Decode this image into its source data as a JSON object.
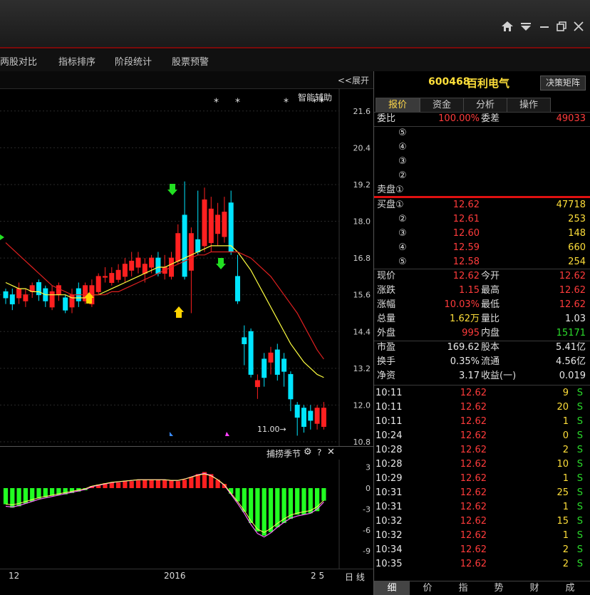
{
  "menu": [
    "两股对比",
    "指标排序",
    "阶段统计",
    "股票预警"
  ],
  "chart_header": {
    "expand_label": "<<展开",
    "assist_label": "智能辅助"
  },
  "y_axis_labels": [
    "21.6",
    "20.4",
    "19.2",
    "18.0",
    "16.8",
    "15.6",
    "14.4",
    "13.2",
    "12.0",
    "10.8"
  ],
  "annot": {
    "low": "11.00→"
  },
  "sub_chart": {
    "title": "捕捞季节",
    "axis": [
      "3",
      "0",
      "-3",
      "-6",
      "-9"
    ]
  },
  "x_axis": {
    "labels": [
      "12",
      "2016",
      "2 5"
    ],
    "period": "日 线"
  },
  "stock": {
    "code": "600468",
    "name": "百利电气",
    "button": "决策矩阵"
  },
  "tabs": [
    "报价",
    "资金",
    "分析",
    "操作"
  ],
  "order_ratio": {
    "label": "委比",
    "value": "100.00%",
    "diff_label": "委差",
    "diff_value": "49033"
  },
  "sell": [
    {
      "label": "⑤",
      "price": "",
      "vol": ""
    },
    {
      "label": "④",
      "price": "",
      "vol": ""
    },
    {
      "label": "③",
      "price": "",
      "vol": ""
    },
    {
      "label": "②",
      "price": "",
      "vol": ""
    },
    {
      "label": "卖盘①",
      "price": "",
      "vol": ""
    }
  ],
  "buy": [
    {
      "label": "买盘①",
      "price": "12.62",
      "vol": "47718"
    },
    {
      "label": "②",
      "price": "12.61",
      "vol": "253"
    },
    {
      "label": "③",
      "price": "12.60",
      "vol": "148"
    },
    {
      "label": "④",
      "price": "12.59",
      "vol": "660"
    },
    {
      "label": "⑤",
      "price": "12.58",
      "vol": "254"
    }
  ],
  "quote": [
    {
      "l1": "现价",
      "v1": "12.62",
      "c1": "red",
      "l2": "今开",
      "v2": "12.62",
      "c2": "red"
    },
    {
      "l1": "涨跌",
      "v1": "1.15",
      "c1": "red",
      "l2": "最高",
      "v2": "12.62",
      "c2": "red"
    },
    {
      "l1": "涨幅",
      "v1": "10.03%",
      "c1": "red",
      "l2": "最低",
      "v2": "12.62",
      "c2": "red"
    },
    {
      "l1": "总量",
      "v1": "1.62万",
      "c1": "yel",
      "l2": "量比",
      "v2": "1.03",
      "c2": "wht"
    },
    {
      "l1": "外盘",
      "v1": "995",
      "c1": "red",
      "l2": "内盘",
      "v2": "15171",
      "c2": "grn"
    }
  ],
  "fund": [
    {
      "l1": "市盈",
      "v1": "169.62",
      "l2": "股本",
      "v2": "5.41亿"
    },
    {
      "l1": "换手",
      "v1": "0.35%",
      "l2": "流通",
      "v2": "4.56亿"
    },
    {
      "l1": "净资",
      "v1": "3.17",
      "l2": "收益(一)",
      "v2": "0.019"
    }
  ],
  "ticks": [
    {
      "t": "10:11",
      "p": "12.62",
      "v": "9",
      "s": "S"
    },
    {
      "t": "10:11",
      "p": "12.62",
      "v": "20",
      "s": "S"
    },
    {
      "t": "10:11",
      "p": "12.62",
      "v": "1",
      "s": "S"
    },
    {
      "t": "10:24",
      "p": "12.62",
      "v": "0",
      "s": "S"
    },
    {
      "t": "10:28",
      "p": "12.62",
      "v": "2",
      "s": "S"
    },
    {
      "t": "10:28",
      "p": "12.62",
      "v": "10",
      "s": "S"
    },
    {
      "t": "10:29",
      "p": "12.62",
      "v": "1",
      "s": "S"
    },
    {
      "t": "10:31",
      "p": "12.62",
      "v": "25",
      "s": "S"
    },
    {
      "t": "10:31",
      "p": "12.62",
      "v": "1",
      "s": "S"
    },
    {
      "t": "10:32",
      "p": "12.62",
      "v": "15",
      "s": "S"
    },
    {
      "t": "10:32",
      "p": "12.62",
      "v": "1",
      "s": "S"
    },
    {
      "t": "10:34",
      "p": "12.62",
      "v": "2",
      "s": "S"
    },
    {
      "t": "10:35",
      "p": "12.62",
      "v": "2",
      "s": "S"
    }
  ],
  "bottom_tabs": [
    "细",
    "价",
    "指",
    "势",
    "财",
    "成"
  ],
  "colors": {
    "up": "#ff2020",
    "down": "#00e5ff",
    "macd_pos": "#ff2020",
    "macd_neg": "#22ff22",
    "ma_short": "#ffff40",
    "ma_long": "#e02020"
  },
  "chart_data": {
    "type": "candlestick",
    "y_range": [
      10.8,
      22.2
    ],
    "candles": [
      [
        15.7,
        15.5,
        15.8,
        15.3
      ],
      [
        15.6,
        15.3,
        15.8,
        15.1
      ],
      [
        15.5,
        15.8,
        16.0,
        15.3
      ],
      [
        15.4,
        15.6,
        15.8,
        15.2
      ],
      [
        15.7,
        15.9,
        16.0,
        15.5
      ],
      [
        16.0,
        15.6,
        16.1,
        15.4
      ],
      [
        15.8,
        15.4,
        15.9,
        15.2
      ],
      [
        15.2,
        15.7,
        15.9,
        15.1
      ],
      [
        15.6,
        15.9,
        16.0,
        15.4
      ],
      [
        15.5,
        15.1,
        15.6,
        15.0
      ],
      [
        15.2,
        15.6,
        15.8,
        15.0
      ],
      [
        15.8,
        15.4,
        16.0,
        15.2
      ],
      [
        15.4,
        15.9,
        16.0,
        15.3
      ],
      [
        15.3,
        15.9,
        16.1,
        15.2
      ],
      [
        15.7,
        16.2,
        16.3,
        15.6
      ],
      [
        16.2,
        16.2,
        16.5,
        16.0
      ],
      [
        16.0,
        16.3,
        16.5,
        15.9
      ],
      [
        16.1,
        16.4,
        16.6,
        16.0
      ],
      [
        16.2,
        16.6,
        16.8,
        16.0
      ],
      [
        16.4,
        16.7,
        17.0,
        16.2
      ],
      [
        16.5,
        16.8,
        17.0,
        16.3
      ],
      [
        16.3,
        16.6,
        16.8,
        16.0
      ],
      [
        16.5,
        16.8,
        16.9,
        16.3
      ],
      [
        16.8,
        16.3,
        17.0,
        16.2
      ],
      [
        16.3,
        16.5,
        16.9,
        16.1
      ],
      [
        16.2,
        16.8,
        17.0,
        16.1
      ],
      [
        16.7,
        17.6,
        17.9,
        16.6
      ],
      [
        18.2,
        16.2,
        19.3,
        16.1
      ],
      [
        16.4,
        17.6,
        17.8,
        15.0
      ],
      [
        17.4,
        17.0,
        19.0,
        16.9
      ],
      [
        17.2,
        18.7,
        19.1,
        17.0
      ],
      [
        17.3,
        18.4,
        18.8,
        17.0
      ],
      [
        17.6,
        18.2,
        18.6,
        17.2
      ],
      [
        17.5,
        18.3,
        18.8,
        17.3
      ],
      [
        18.6,
        17.0,
        19.0,
        16.9
      ],
      [
        16.2,
        15.4,
        16.9,
        15.3
      ],
      [
        14.2,
        14.0,
        14.6,
        13.3
      ],
      [
        14.4,
        13.0,
        14.5,
        12.9
      ],
      [
        12.6,
        12.8,
        13.0,
        12.2
      ],
      [
        13.5,
        12.9,
        13.7,
        12.6
      ],
      [
        13.4,
        13.7,
        13.9,
        13.0
      ],
      [
        13.8,
        13.0,
        14.0,
        12.8
      ],
      [
        13.5,
        13.1,
        13.7,
        12.6
      ],
      [
        13.0,
        12.2,
        13.1,
        11.8
      ],
      [
        12.0,
        11.6,
        12.1,
        11.0
      ],
      [
        11.9,
        11.3,
        12.0,
        11.1
      ],
      [
        11.8,
        11.5,
        12.0,
        11.2
      ],
      [
        11.4,
        11.9,
        12.0,
        11.2
      ],
      [
        11.3,
        11.9,
        12.1,
        11.2
      ]
    ],
    "ma_short": [
      16.0,
      15.9,
      15.8,
      15.8,
      15.7,
      15.7,
      15.6,
      15.6,
      15.6,
      15.6,
      15.5,
      15.5,
      15.5,
      15.6,
      15.6,
      15.7,
      15.8,
      15.9,
      16.0,
      16.1,
      16.2,
      16.3,
      16.4,
      16.5,
      16.5,
      16.6,
      16.7,
      16.8,
      16.9,
      17.0,
      17.1,
      17.2,
      17.2,
      17.2,
      17.2,
      17.0,
      16.7,
      16.4,
      16.0,
      15.6,
      15.2,
      14.8,
      14.4,
      14.0,
      13.7,
      13.4,
      13.2,
      13.0,
      12.9
    ],
    "ma_long": [
      17.3,
      17.1,
      16.9,
      16.7,
      16.5,
      16.3,
      16.1,
      15.9,
      15.8,
      15.7,
      15.6,
      15.6,
      15.6,
      15.6,
      15.6,
      15.6,
      15.7,
      15.7,
      15.8,
      15.9,
      16.0,
      16.1,
      16.2,
      16.3,
      16.4,
      16.5,
      16.6,
      16.7,
      16.8,
      16.9,
      16.9,
      17.0,
      17.0,
      17.0,
      17.0,
      17.0,
      16.9,
      16.8,
      16.6,
      16.4,
      16.2,
      15.9,
      15.6,
      15.3,
      15.0,
      14.6,
      14.2,
      13.8,
      13.5
    ],
    "macd": [
      -2.3,
      -2.8,
      -2.6,
      -2.2,
      -1.9,
      -1.5,
      -1.3,
      -1.1,
      -1.0,
      -0.9,
      -0.7,
      -0.5,
      -0.3,
      0.3,
      0.5,
      0.7,
      0.8,
      0.8,
      1.0,
      1.0,
      1.1,
      1.2,
      1.2,
      1.2,
      1.2,
      1.1,
      1.0,
      1.2,
      1.6,
      2.0,
      2.3,
      2.0,
      1.2,
      0.6,
      -0.8,
      -1.9,
      -3.4,
      -5.0,
      -6.2,
      -6.8,
      -6.3,
      -5.6,
      -5.0,
      -4.4,
      -3.8,
      -3.8,
      -3.6,
      -3.3,
      -1.8
    ],
    "macd_line": [
      -2.6,
      -2.7,
      -2.5,
      -2.2,
      -1.9,
      -1.6,
      -1.4,
      -1.2,
      -1.0,
      -0.8,
      -0.6,
      -0.4,
      -0.2,
      0.2,
      0.4,
      0.6,
      0.8,
      0.9,
      1.0,
      1.1,
      1.2,
      1.2,
      1.2,
      1.2,
      1.2,
      1.1,
      1.1,
      1.3,
      1.6,
      1.9,
      2.1,
      1.8,
      1.2,
      0.4,
      -0.9,
      -2.2,
      -3.6,
      -5.2,
      -6.5,
      -7.0,
      -6.4,
      -5.6,
      -4.9,
      -4.3,
      -4.0,
      -3.8,
      -3.6,
      -3.0,
      -2.0
    ]
  }
}
